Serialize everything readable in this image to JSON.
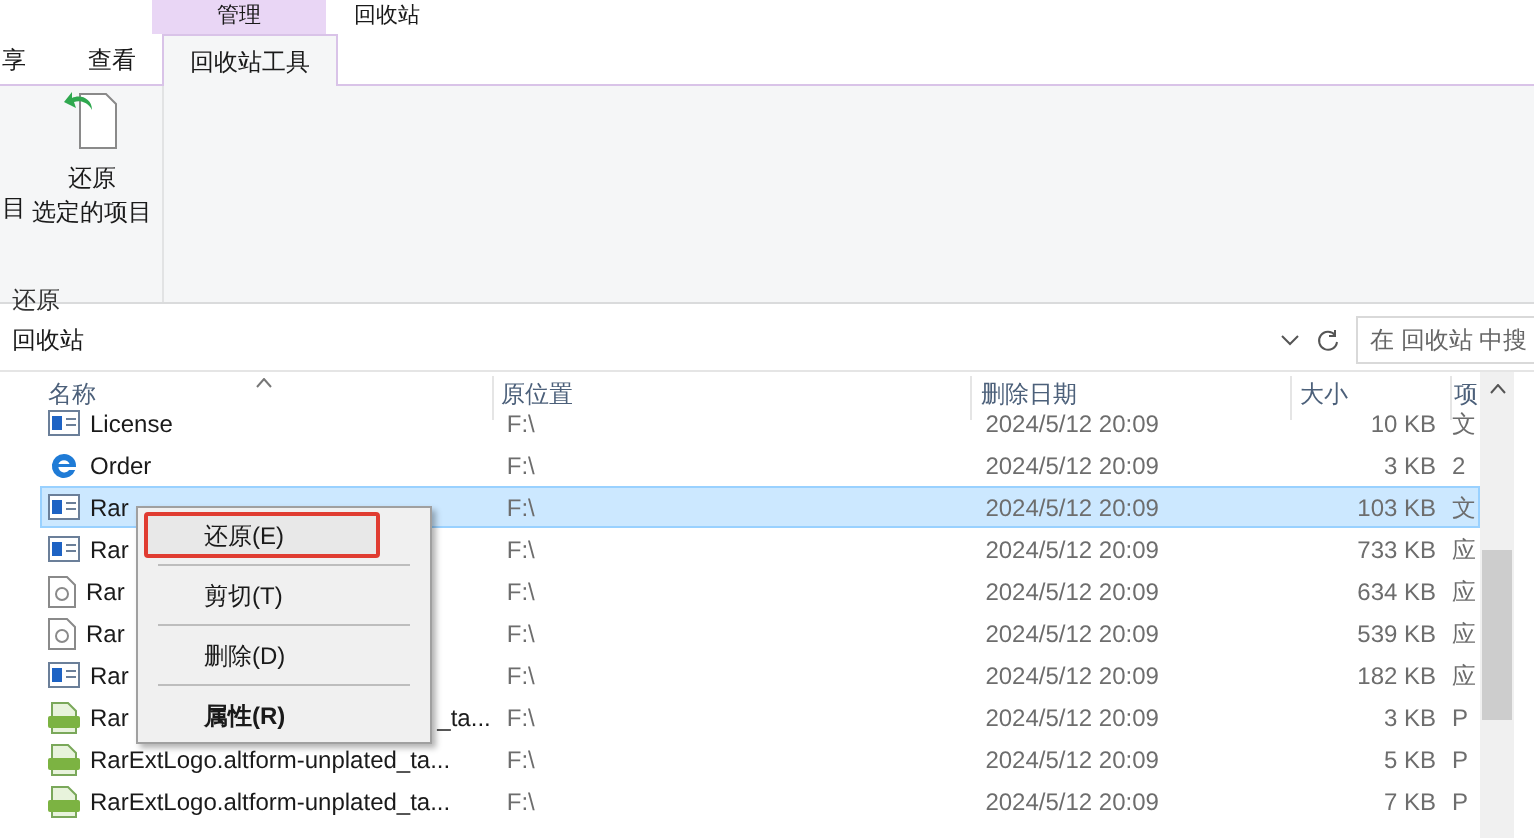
{
  "ribbon": {
    "context_header": "管理",
    "window_title": "回收站",
    "tabs": [
      {
        "label": "享",
        "selected": false
      },
      {
        "label": "查看",
        "selected": false
      },
      {
        "label": "回收站工具",
        "selected": true
      }
    ],
    "cut_label": "目",
    "restore_button": {
      "line1": "还原",
      "line2": "选定的项目"
    },
    "group_label": "还原"
  },
  "address_bar": {
    "path": "回收站",
    "search_placeholder": "在 回收站 中搜"
  },
  "table": {
    "columns": [
      "名称",
      "原位置",
      "删除日期",
      "大小",
      "项"
    ],
    "rows": [
      {
        "kind": "app",
        "name": "License",
        "location": "F:\\",
        "date": "2024/5/12 20:09",
        "size": "10 KB",
        "column_5": "文",
        "selected": false
      },
      {
        "kind": "ie",
        "name": "Order",
        "location": "F:\\",
        "date": "2024/5/12 20:09",
        "size": "3 KB",
        "column_5": "2",
        "selected": false
      },
      {
        "kind": "app",
        "name": "Rar",
        "location": "F:\\",
        "date": "2024/5/12 20:09",
        "size": "103 KB",
        "column_5": "文",
        "selected": true
      },
      {
        "kind": "app",
        "name": "Rar",
        "location": "F:\\",
        "date": "2024/5/12 20:09",
        "size": "733 KB",
        "column_5": "应",
        "selected": false
      },
      {
        "kind": "doc",
        "name": "Rar",
        "location": "F:\\",
        "date": "2024/5/12 20:09",
        "size": "634 KB",
        "column_5": "应",
        "selected": false
      },
      {
        "kind": "doc",
        "name": "Rar",
        "location": "F:\\",
        "date": "2024/5/12 20:09",
        "size": "539 KB",
        "column_5": "应",
        "selected": false
      },
      {
        "kind": "app",
        "name": "Rar",
        "location": "F:\\",
        "date": "2024/5/12 20:09",
        "size": "182 KB",
        "column_5": "应",
        "selected": false
      },
      {
        "kind": "png",
        "name": "Rar",
        "name_tail": "_ta...",
        "location": "F:\\",
        "date": "2024/5/12 20:09",
        "size": "3 KB",
        "column_5": "P",
        "selected": false
      },
      {
        "kind": "png",
        "name": "RarExtLogo.altform-unplated_ta...",
        "location": "F:\\",
        "date": "2024/5/12 20:09",
        "size": "5 KB",
        "column_5": "P",
        "selected": false
      },
      {
        "kind": "png",
        "name": "RarExtLogo.altform-unplated_ta...",
        "location": "F:\\",
        "date": "2024/5/12 20:09",
        "size": "7 KB",
        "column_5": "P",
        "selected": false
      }
    ]
  },
  "context_menu": {
    "items": [
      {
        "label": "还原(E)",
        "highlighted": true
      },
      {
        "label": "剪切(T)",
        "highlighted": false
      },
      {
        "label": "删除(D)",
        "highlighted": false
      },
      {
        "label": "**属性(R)**",
        "highlighted": false
      }
    ]
  }
}
